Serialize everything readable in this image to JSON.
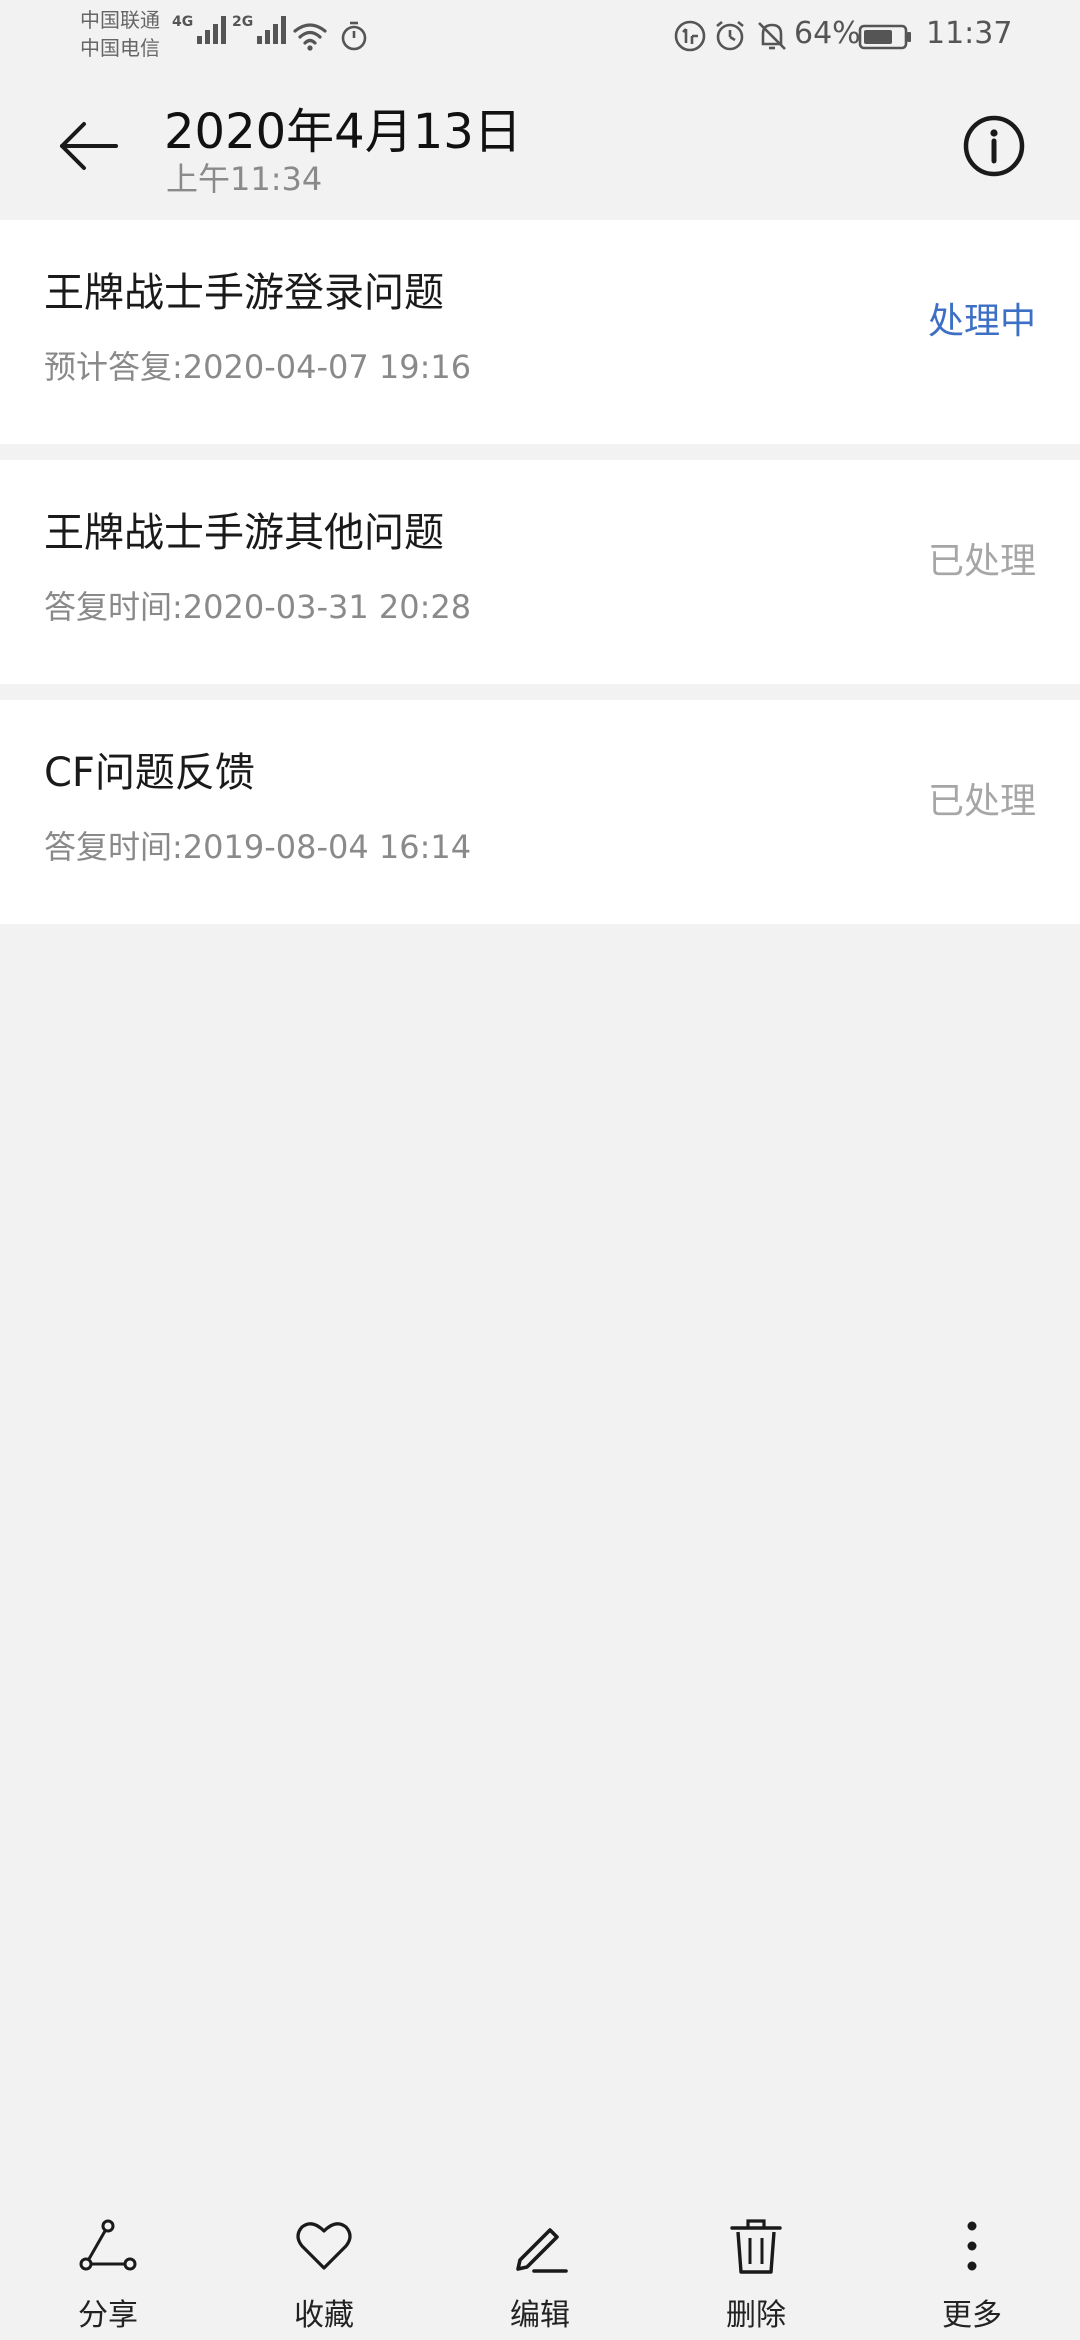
{
  "status_bar": {
    "carrier_1": "中国联通",
    "carrier_2": "中国电信",
    "net_1": "4G",
    "net_2": "2G",
    "battery_percent": "64%",
    "time": "11:37"
  },
  "header": {
    "title": "2020年4月13日",
    "subtitle": "上午11:34"
  },
  "items": [
    {
      "title": "王牌战士手游登录问题",
      "subtitle": "预计答复:2020-04-07 19:16",
      "status": "处理中"
    },
    {
      "title": "王牌战士手游其他问题",
      "subtitle": "答复时间:2020-03-31 20:28",
      "status": "已处理"
    },
    {
      "title": "CF问题反馈",
      "subtitle": "答复时间:2019-08-04 16:14",
      "status": "已处理"
    }
  ],
  "toolbar": {
    "share": "分享",
    "favorite": "收藏",
    "edit": "编辑",
    "delete": "删除",
    "more": "更多"
  },
  "colors": {
    "background": "#f2f2f2",
    "status_processing": "#3d6fc4",
    "status_done": "#a6a6a6"
  }
}
